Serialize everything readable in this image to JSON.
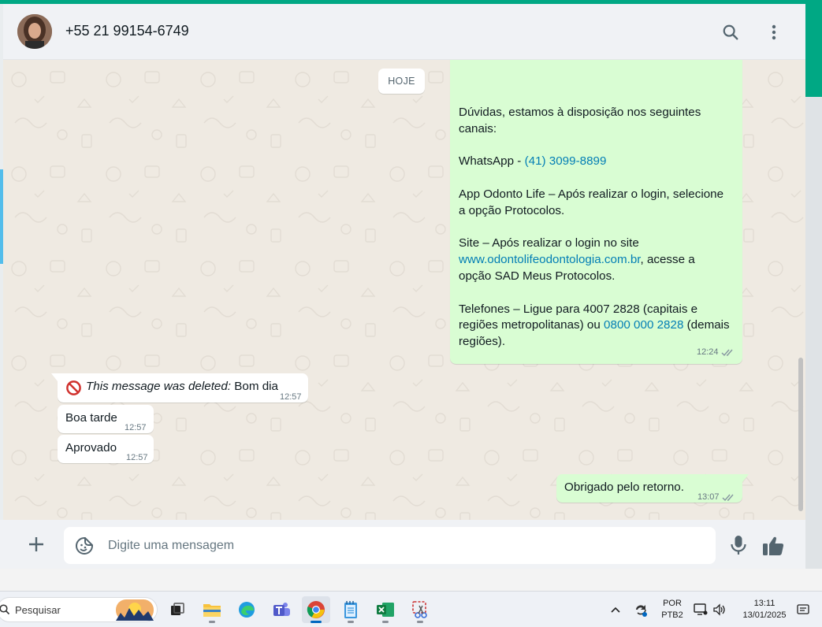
{
  "header": {
    "contact_name": "+55 21 99154-6749"
  },
  "chat": {
    "date_separator": "HOJE",
    "big_message": {
      "line1": "Dúvidas, estamos à disposição nos seguintes",
      "line2": "canais:",
      "whatsapp_prefix": "WhatsApp - ",
      "whatsapp_number": "(41) 3099-8899",
      "app_line1": "App Odonto Life – Após realizar o login, selecione",
      "app_line2": "a opção Protocolos.",
      "site_line1": "Site – Após realizar o login no site",
      "site_link": "www.odontolifeodontologia.com.br",
      "site_rest": ", acesse a",
      "site_line3": "opção SAD Meus Protocolos.",
      "phones_line1": "Telefones – Ligue para 4007 2828 (capitais e",
      "phones_line2_a": "regiões metropolitanas) ou ",
      "phones_link": "0800 000 2828",
      "phones_line2_b": " (demais",
      "phones_line3": "regiões).",
      "time": "12:24"
    },
    "deleted_message": {
      "label": "This message was deleted:",
      "text": " Bom dia",
      "time": "12:57"
    },
    "msg_boa_tarde": {
      "text": "Boa tarde",
      "time": "12:57"
    },
    "msg_aprovado": {
      "text": "Aprovado",
      "time": "12:57"
    },
    "msg_obrigado": {
      "text": "Obrigado pelo retorno.",
      "time": "13:07"
    }
  },
  "composer": {
    "placeholder": "Digite uma mensagem"
  },
  "taskbar": {
    "search_placeholder": "Pesquisar",
    "language_top": "POR",
    "language_bottom": "PTB2",
    "time": "13:11",
    "date": "13/01/2025"
  },
  "colors": {
    "accent": "#00a884",
    "outgoing_bubble": "#d9fdd3",
    "incoming_bubble": "#ffffff",
    "chat_background": "#efeae2",
    "link": "#027eb5"
  }
}
